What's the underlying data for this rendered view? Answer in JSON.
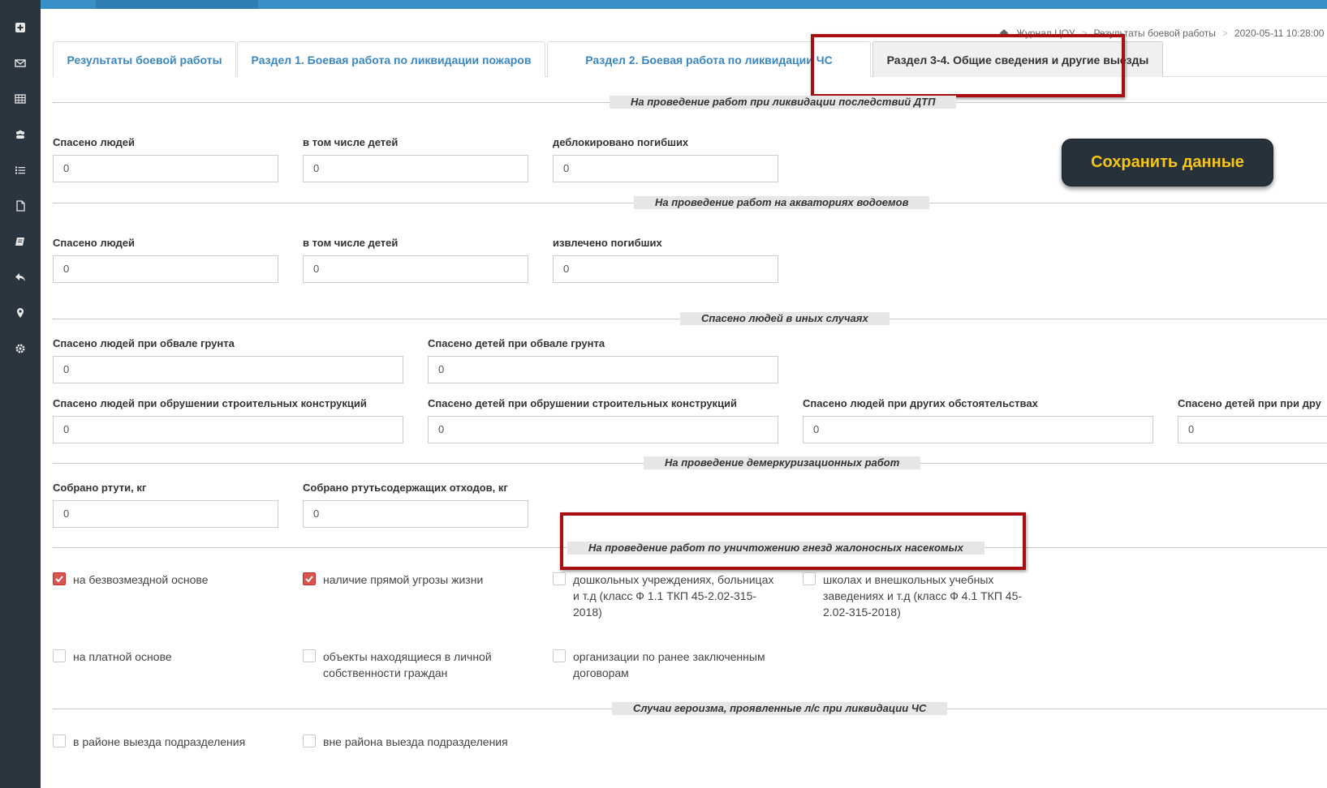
{
  "breadcrumb": {
    "items": [
      "Журнал ЦОУ",
      "Результаты боевой работы",
      "2020-05-11 10:28:00"
    ]
  },
  "tabs": [
    {
      "label": "Результаты боевой работы"
    },
    {
      "label": "Раздел 1. Боевая работа по ликвидации пожаров"
    },
    {
      "label": "Раздел 2. Боевая работа по ликвидации ЧС"
    },
    {
      "label": "Раздел 3-4. Общие сведения и другие выезды"
    }
  ],
  "save_button": {
    "label": "Сохранить данные"
  },
  "sections": {
    "dtp": {
      "title": "На проведение работ при ликвидации последствий ДТП",
      "fields": [
        {
          "label": "Спасено людей",
          "value": "0"
        },
        {
          "label": "в том числе детей",
          "value": "0"
        },
        {
          "label": "деблокировано погибших",
          "value": "0"
        }
      ]
    },
    "water": {
      "title": "На проведение работ на акваториях водоемов",
      "fields": [
        {
          "label": "Спасено людей",
          "value": "0"
        },
        {
          "label": "в том числе детей",
          "value": "0"
        },
        {
          "label": "извлечено погибших",
          "value": "0"
        }
      ]
    },
    "other": {
      "title": "Спасено людей в иных случаях",
      "fields": [
        {
          "label": "Спасено людей при обвале грунта",
          "value": "0"
        },
        {
          "label": "Спасено детей при обвале грунта",
          "value": "0"
        },
        {
          "label": "Спасено людей при обрушении строительных конструкций",
          "value": "0"
        },
        {
          "label": "Спасено детей при обрушении строительных конструкций",
          "value": "0"
        },
        {
          "label": "Спасено людей при других обстоятельствах",
          "value": "0"
        },
        {
          "label": "Спасено детей при при дру",
          "value": "0"
        }
      ]
    },
    "demerc": {
      "title": "На проведение демеркуризационных работ",
      "fields": [
        {
          "label": "Собрано ртути, кг",
          "value": "0"
        },
        {
          "label": "Собрано ртутьсодержащих отходов, кг",
          "value": "0"
        }
      ]
    },
    "insects": {
      "title": "На проведение работ по уничтожению гнезд жалоносных насекомых",
      "checks": [
        {
          "label": "на безвозмездной основе",
          "checked": true
        },
        {
          "label": "наличие прямой угрозы жизни",
          "checked": true
        },
        {
          "label": "дошкольных учреждениях, больницах и т.д (класс Ф 1.1 ТКП 45-2.02-315-2018)",
          "checked": false
        },
        {
          "label": "школах и внешкольных учебных заведениях и т.д (класс Ф 4.1 ТКП 45-2.02-315-2018)",
          "checked": false
        },
        {
          "label": "на платной основе",
          "checked": false
        },
        {
          "label": "объекты находящиеся в личной собственности граждан",
          "checked": false
        },
        {
          "label": "организации по ранее заключенным договорам",
          "checked": false
        }
      ]
    },
    "heroism": {
      "title": "Случаи героизма, проявленные л/с при ликвидации ЧС",
      "checks": [
        {
          "label": "в районе выезда подразделения",
          "checked": false
        },
        {
          "label": "вне района выезда подразделения",
          "checked": false
        }
      ]
    }
  },
  "sidebar": {
    "icons": [
      "plus-square-icon",
      "envelope-icon",
      "table-icon",
      "users-icon",
      "list-icon",
      "file-icon",
      "book-icon",
      "reply-icon",
      "map-marker-icon",
      "gear-icon"
    ]
  },
  "colors": {
    "sidebar": "#2b3540",
    "accent": "#3a87c1",
    "highlight": "#a90f12",
    "save_text": "#f5c518",
    "check_red": "#d9534f"
  }
}
